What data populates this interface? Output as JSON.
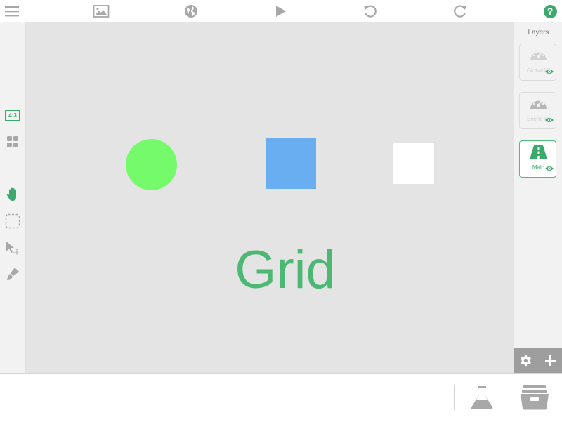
{
  "theme": {
    "accent": "#3aa96b",
    "icon_gray": "#a8a8a8",
    "canvas_bg": "#e4e4e4",
    "panel_bg": "#f2f2f2"
  },
  "top_toolbar": {
    "menu_icon": "hamburger-menu-icon",
    "image_icon": "image-icon",
    "globe_icon": "globe-icon",
    "play_icon": "play-icon",
    "undo_icon": "undo-icon",
    "redo_icon": "redo-icon",
    "help_icon": "help-icon",
    "help_text": "?"
  },
  "left_toolbar": {
    "aspect_ratio": "4:3",
    "tools": [
      "grid-view-icon",
      "hand-pan-icon",
      "marquee-select-icon",
      "select-move-icon",
      "brush-icon"
    ]
  },
  "canvas": {
    "objects": [
      {
        "type": "circle",
        "color": "#74fa6a"
      },
      {
        "type": "square",
        "color": "#6aaef2"
      },
      {
        "type": "square",
        "color": "#ffffff"
      }
    ],
    "text_object": {
      "text": "Grid",
      "color": "#4cb874"
    }
  },
  "layers_panel": {
    "title": "Layers",
    "layers": [
      {
        "name": "Global UI",
        "icon": "gauge-icon",
        "visible": true,
        "active": false
      },
      {
        "name": "Scene UI",
        "icon": "gauge-icon",
        "visible": true,
        "active": false
      },
      {
        "name": "Main",
        "icon": "road-icon",
        "visible": true,
        "active": true
      }
    ],
    "footer": {
      "settings_icon": "gear-icon",
      "add_icon": "plus-icon"
    }
  },
  "bottom_bar": {
    "lab_icon": "flask-icon",
    "library_icon": "archive-box-icon"
  }
}
